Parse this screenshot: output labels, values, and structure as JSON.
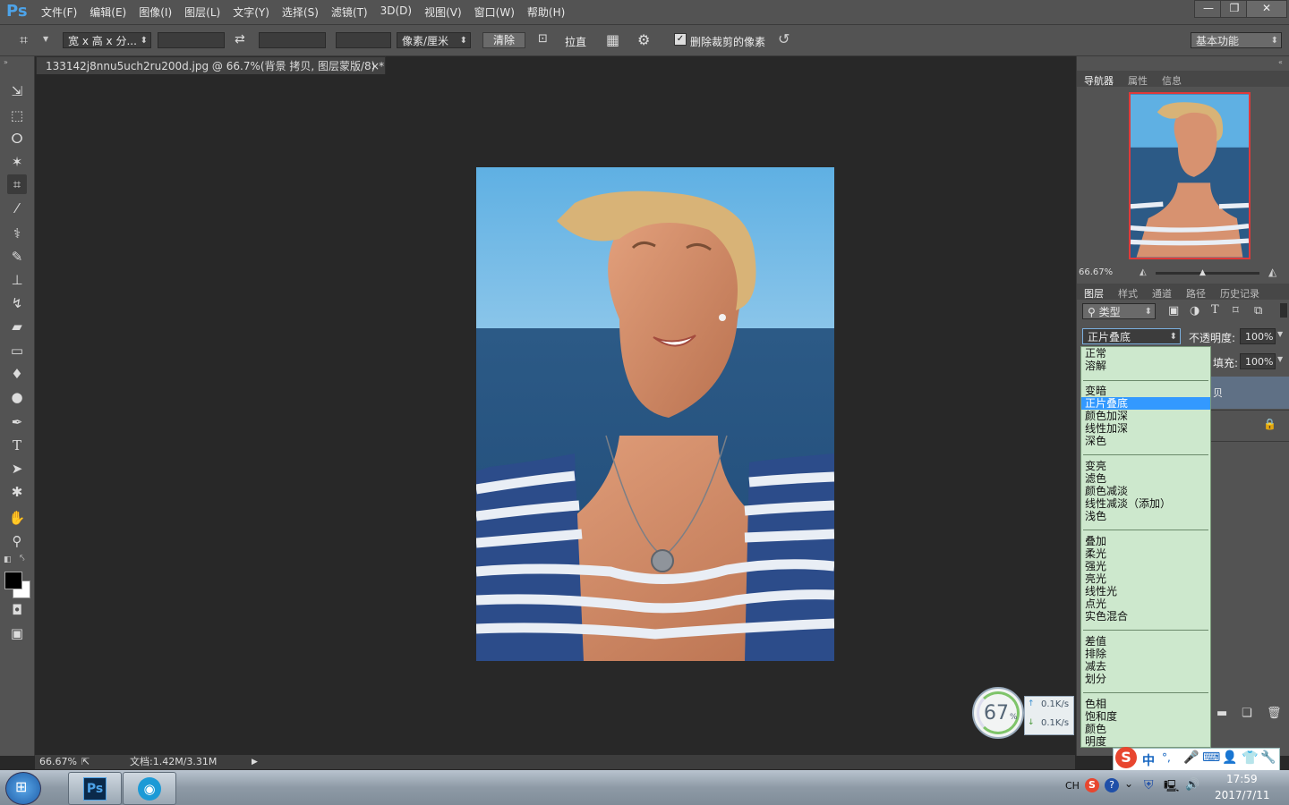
{
  "app": {
    "logo": "Ps",
    "menu": [
      "文件(F)",
      "编辑(E)",
      "图像(I)",
      "图层(L)",
      "文字(Y)",
      "选择(S)",
      "滤镜(T)",
      "3D(D)",
      "视图(V)",
      "窗口(W)",
      "帮助(H)"
    ],
    "window_controls": {
      "minimize": "—",
      "restore": "❐",
      "close": "✕"
    }
  },
  "options": {
    "ratio_value": "宽 x 高 x 分...",
    "swap_icon": "swap-icon",
    "unit_value": "像素/厘米",
    "clear_label": "清除",
    "straighten_label": "拉直",
    "delete_cropped_label": "删除裁剪的像素",
    "delete_cropped_checked": true,
    "workspace_value": "基本功能"
  },
  "tools": [
    "move-tool",
    "marquee-tool",
    "lasso-tool",
    "magic-wand-tool",
    "crop-tool",
    "eyedropper-tool",
    "healing-brush-tool",
    "brush-tool",
    "clone-stamp-tool",
    "history-brush-tool",
    "eraser-tool",
    "gradient-tool",
    "blur-tool",
    "dodge-tool",
    "pen-tool",
    "type-tool",
    "path-selection-tool",
    "shape-tool",
    "hand-tool",
    "zoom-tool"
  ],
  "document": {
    "tab_title": "133142j8nnu5uch2ru200d.jpg @ 66.7%(背景 拷贝, 图层蒙版/8) *",
    "tab_close": "×"
  },
  "status": {
    "zoom": "66.67%",
    "doc_size": "文档:1.42M/3.31M",
    "arrow": "▶"
  },
  "navigator": {
    "tabs": [
      "导航器",
      "属性",
      "信息"
    ],
    "zoom": "66.67%"
  },
  "layers": {
    "tabs": [
      "图层",
      "样式",
      "通道",
      "路径",
      "历史记录"
    ],
    "filter_value": "类型",
    "blend_mode": "正片叠底",
    "opacity_label": "不透明度:",
    "opacity_value": "100%",
    "fill_label": "填充:",
    "fill_value": "100%",
    "layer_partial_label": "贝"
  },
  "blend_groups": [
    [
      "正常",
      "溶解"
    ],
    [
      "变暗",
      "正片叠底",
      "颜色加深",
      "线性加深",
      "深色"
    ],
    [
      "变亮",
      "滤色",
      "颜色减淡",
      "线性减淡（添加）",
      "浅色"
    ],
    [
      "叠加",
      "柔光",
      "强光",
      "亮光",
      "线性光",
      "点光",
      "实色混合"
    ],
    [
      "差值",
      "排除",
      "减去",
      "划分"
    ],
    [
      "色相",
      "饱和度",
      "颜色",
      "明度"
    ]
  ],
  "blend_selected": "正片叠底",
  "speed_widget": {
    "percent": "67",
    "percent_sign": "%",
    "up": "0.1K/s",
    "down": "0.1K/s"
  },
  "ime": {
    "mode": "中",
    "punct": "°,"
  },
  "taskbar": {
    "lang": "CH",
    "time": "17:59",
    "date": "2017/7/11"
  }
}
